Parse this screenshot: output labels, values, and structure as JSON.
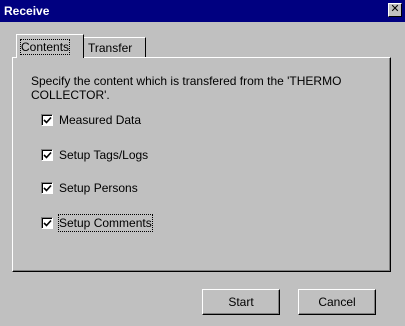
{
  "window": {
    "title": "Receive",
    "close_glyph": "✕"
  },
  "tabs": [
    {
      "label": "Contents",
      "active": true
    },
    {
      "label": "Transfer",
      "active": false
    }
  ],
  "contents": {
    "description": "Specify the content which is transfered from the 'THERMO COLLECTOR'.",
    "options": [
      {
        "label": "Measured Data",
        "checked": true
      },
      {
        "label": "Setup Tags/Logs",
        "checked": true
      },
      {
        "label": "Setup Persons",
        "checked": true
      },
      {
        "label": "Setup Comments",
        "checked": true,
        "focused": true
      }
    ]
  },
  "buttons": {
    "start": "Start",
    "cancel": "Cancel"
  },
  "colors": {
    "titlebar": "#000080",
    "face": "#c0c0c0"
  }
}
